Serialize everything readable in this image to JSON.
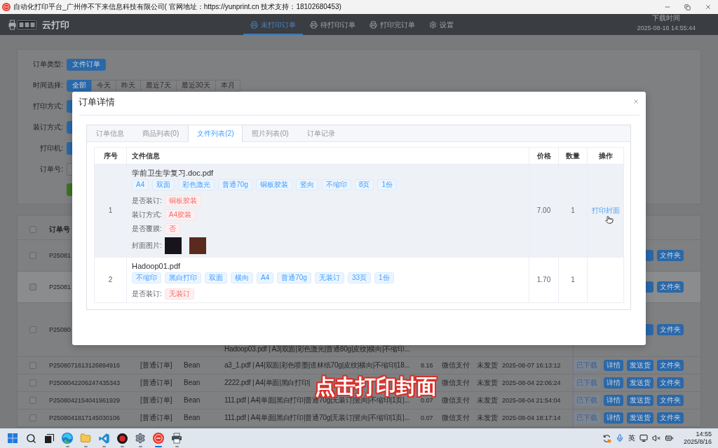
{
  "window": {
    "title": "自动化打印平台_广州停不下来信息科技有限公司( 官网地址：https://yunprint.cn 技术支持：18102680453)"
  },
  "header": {
    "app_name": "云打印",
    "nav": [
      {
        "kind": "printer",
        "label": "未打印订单",
        "selected": true
      },
      {
        "kind": "printer",
        "label": "待打印订单",
        "selected": false
      },
      {
        "kind": "printer",
        "label": "打印完订单",
        "selected": false
      },
      {
        "kind": "gear",
        "label": "设置",
        "selected": false
      }
    ],
    "download_label": "下载时间",
    "download_time": "2025-08-16 14:55:44"
  },
  "filters": [
    {
      "kind": "options",
      "label": "订单类型:",
      "options": [
        {
          "label": "文件订单",
          "selected": true
        }
      ]
    },
    {
      "kind": "options",
      "label": "时间选择:",
      "options": [
        {
          "label": "全部",
          "selected": true
        },
        {
          "label": "今天",
          "selected": false
        },
        {
          "label": "昨天",
          "selected": false
        },
        {
          "label": "最近7天",
          "selected": false
        },
        {
          "label": "最近30天",
          "selected": false
        },
        {
          "label": "本月",
          "selected": false
        }
      ]
    },
    {
      "kind": "covered",
      "label": "打印方式:"
    },
    {
      "kind": "covered",
      "label": "装订方式:"
    },
    {
      "kind": "covered",
      "label": "打印机:"
    },
    {
      "kind": "field",
      "label": "订单号:"
    },
    {
      "kind": "action"
    }
  ],
  "orders": {
    "header": {
      "label": "订单号",
      "checked": false
    },
    "rows": [
      {
        "kind": "partial",
        "checked": false,
        "highlighted": false,
        "order_no": "P25081",
        "actions": [
          {
            "label": "文件夹",
            "disabled": false
          }
        ]
      },
      {
        "kind": "partial",
        "checked": false,
        "highlighted": true,
        "order_no": "P25081",
        "actions": [
          {
            "label": "文件夹",
            "disabled": false
          }
        ]
      },
      {
        "kind": "partial",
        "checked": false,
        "highlighted": false,
        "order_no": "P25080",
        "files": "Hadoop03.pdf | A3|双面|彩色激光|普通80g|皮纹|横向|不缩印...",
        "actions": [
          {
            "label": "文件夹",
            "disabled": false
          }
        ]
      },
      {
        "kind": "full",
        "checked": false,
        "highlighted": false,
        "order_no": "P2508071613126894916",
        "type": "[普通订单]",
        "user": "Bean",
        "files": "a3_1.pdf | A4|双面|彩色喷墨|道林纸70g|皮纹|横向|不缩印|18...",
        "price": "8.16",
        "payment": "微信支付",
        "status": "未发货",
        "time": "2025-08-07 16:13:12",
        "actions": [
          {
            "label": "已下载",
            "disabled": true
          },
          {
            "label": "详情",
            "disabled": false
          },
          {
            "label": "发送货",
            "disabled": false
          },
          {
            "label": "文件夹",
            "disabled": false
          }
        ]
      },
      {
        "kind": "full",
        "checked": false,
        "highlighted": false,
        "order_no": "P2508042206247435343",
        "type": "[普通订单]",
        "user": "Bean",
        "files": "2222.pdf | A4|单面|黑白打印|",
        "payment": "微信支付",
        "status": "未发货",
        "time": "2025-08-04 22:06:24",
        "actions": [
          {
            "label": "已下载",
            "disabled": true
          },
          {
            "label": "详情",
            "disabled": false
          },
          {
            "label": "发送货",
            "disabled": false
          },
          {
            "label": "文件夹",
            "disabled": false
          }
        ]
      },
      {
        "kind": "full",
        "checked": false,
        "highlighted": false,
        "order_no": "P2508042154041961929",
        "type": "[普通订单]",
        "user": "Bean",
        "files": "111.pdf | A4|单面|黑白打印|普通70g|无装订|竖向|不缩印|1页|...",
        "price": "0.07",
        "payment": "微信支付",
        "status": "未发货",
        "time": "2025-08-04 21:54:04",
        "actions": [
          {
            "label": "已下载",
            "disabled": true
          },
          {
            "label": "详情",
            "disabled": false
          },
          {
            "label": "发送货",
            "disabled": false
          },
          {
            "label": "文件夹",
            "disabled": false
          }
        ]
      },
      {
        "kind": "full",
        "checked": false,
        "highlighted": false,
        "order_no": "P2508041817145030106",
        "type": "[普通订单]",
        "user": "Bean",
        "files": "111.pdf | A4|单面|黑白打印|普通70g|无装订|竖向|不缩印|1页|...",
        "price": "0.07",
        "payment": "微信支付",
        "status": "未发货",
        "time": "2025-08-04 18:17:14",
        "actions": [
          {
            "label": "已下载",
            "disabled": true
          },
          {
            "label": "详情",
            "disabled": false
          },
          {
            "label": "发送货",
            "disabled": false
          },
          {
            "label": "文件夹",
            "disabled": false
          }
        ]
      }
    ]
  },
  "dialog": {
    "title": "订单详情",
    "tabs": [
      {
        "label": "订单信息",
        "selected": false
      },
      {
        "label": "商品列表(0)",
        "selected": false
      },
      {
        "label": "文件列表(2)",
        "selected": true
      },
      {
        "label": "照片列表(0)",
        "selected": false
      },
      {
        "label": "订单记录",
        "selected": false
      }
    ],
    "columns": [
      "序号",
      "文件信息",
      "价格",
      "数量",
      "操作"
    ],
    "files": [
      {
        "index": "1",
        "name": "学前卫生学复习.doc.pdf",
        "hovered": true,
        "tags": [
          "A4",
          "双面",
          "彩色激光",
          "普通70g",
          "铜板胶装",
          "竖向",
          "不缩印",
          "8页",
          "1份"
        ],
        "details": [
          {
            "kind": "tag",
            "label": "是否装订:",
            "value": "铜板胶装"
          },
          {
            "kind": "tag",
            "label": "装订方式:",
            "value": "A4胶装"
          },
          {
            "kind": "tag",
            "label": "是否覆膜:",
            "value": "否"
          },
          {
            "kind": "images",
            "label": "封面图片:",
            "images": [
              {
                "kind": "photo"
              },
              {
                "kind": "photo"
              }
            ]
          }
        ],
        "price": "7.00",
        "quantity": "1",
        "action": "打印封面"
      },
      {
        "index": "2",
        "name": "Hadoop01.pdf",
        "hovered": false,
        "tags": [
          "不缩印",
          "黑白打印",
          "双面",
          "横向",
          "A4",
          "普通70g",
          "无装订",
          "33页",
          "1份"
        ],
        "details": [
          {
            "kind": "tag",
            "label": "是否装订:",
            "value": "无装订"
          }
        ],
        "price": "1.70",
        "quantity": "1"
      }
    ]
  },
  "caption": "点击打印封面",
  "taskbar": {
    "apps": [
      {
        "kind": "start",
        "running": false,
        "selected": false
      },
      {
        "kind": "search",
        "running": false,
        "selected": false
      },
      {
        "kind": "taskview",
        "running": false,
        "selected": false
      },
      {
        "kind": "browser",
        "running": true,
        "selected": false
      },
      {
        "kind": "folder",
        "running": true,
        "selected": false
      },
      {
        "kind": "editor",
        "running": true,
        "selected": false
      },
      {
        "kind": "recorder",
        "running": true,
        "selected": false
      },
      {
        "kind": "settings",
        "running": true,
        "selected": false
      },
      {
        "kind": "stamp",
        "running": true,
        "selected": true
      },
      {
        "kind": "printer",
        "running": true,
        "selected": false
      }
    ],
    "ime": "英",
    "time": "14:55",
    "date": "2025/8/16"
  }
}
